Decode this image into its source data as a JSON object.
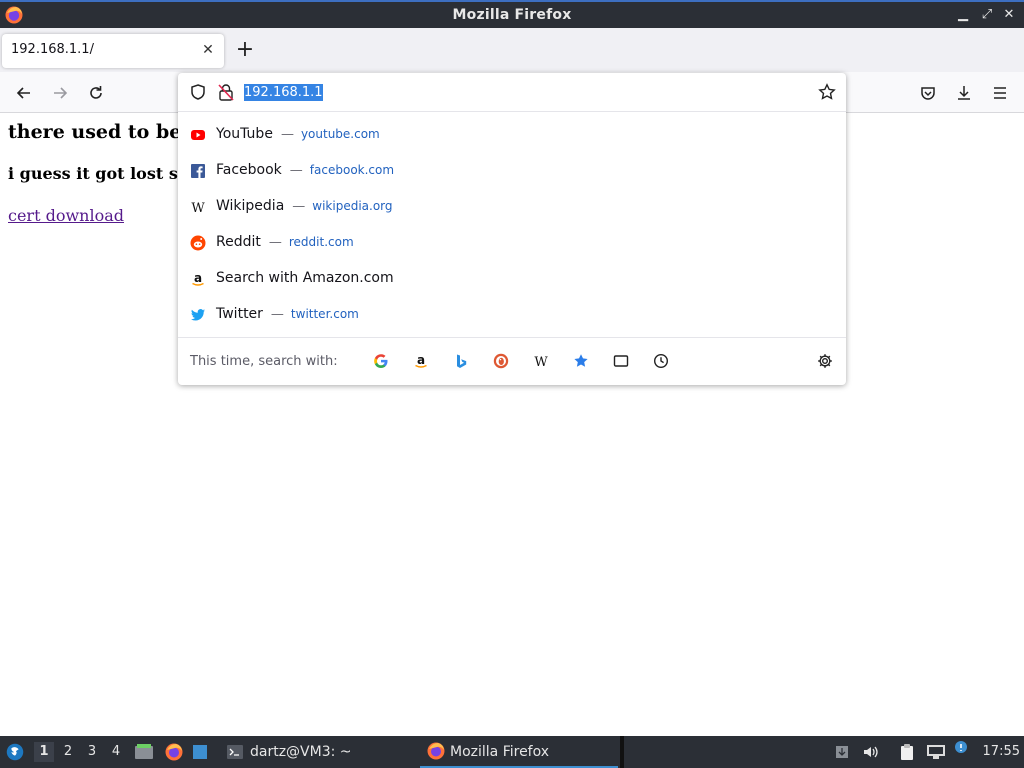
{
  "window": {
    "title": "Mozilla Firefox",
    "minimize_glyph": "▁",
    "maximize_glyph": "⤢",
    "close_glyph": "✕"
  },
  "tabs": [
    {
      "label": "192.168.1.1/",
      "close_glyph": "✕"
    }
  ],
  "new_tab_glyph": "+",
  "urlbar": {
    "value": "192.168.1.1"
  },
  "suggestions": [
    {
      "title": "YouTube",
      "url": "youtube.com",
      "icon": "youtube-icon"
    },
    {
      "title": "Facebook",
      "url": "facebook.com",
      "icon": "facebook-icon"
    },
    {
      "title": "Wikipedia",
      "url": "wikipedia.org",
      "icon": "wikipedia-icon"
    },
    {
      "title": "Reddit",
      "url": "reddit.com",
      "icon": "reddit-icon"
    },
    {
      "title": "Search with Amazon.com",
      "url": "",
      "icon": "amazon-icon"
    },
    {
      "title": "Twitter",
      "url": "twitter.com",
      "icon": "twitter-icon"
    }
  ],
  "one_off": {
    "label": "This time, search with:",
    "engines": [
      "google-icon",
      "amazon-icon",
      "bing-icon",
      "duckduckgo-icon",
      "wikipedia-icon",
      "bookmarks-icon",
      "tabs-icon",
      "history-icon"
    ]
  },
  "page": {
    "heading1": "there used to be",
    "heading2": "i guess it got lost s",
    "link": "cert download"
  },
  "taskbar": {
    "workspaces": [
      "1",
      "2",
      "3",
      "4"
    ],
    "tasks": [
      {
        "label": "dartz@VM3: ~",
        "icon": "terminal-icon"
      },
      {
        "label": "Mozilla Firefox",
        "icon": "firefox-icon"
      }
    ],
    "clock": "17:55"
  },
  "colors": {
    "accent": "#3584e4",
    "link_visited": "#551a8b",
    "suggestion_url": "#2262bf",
    "panel_bg": "#2b2f36"
  }
}
